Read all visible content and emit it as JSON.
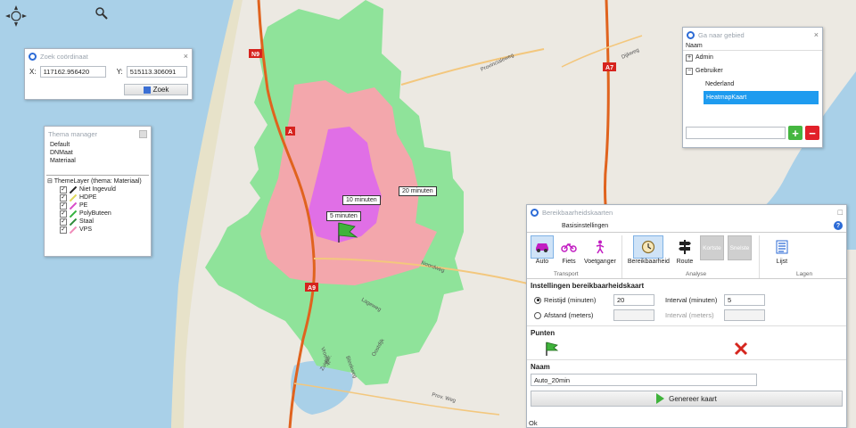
{
  "map": {
    "road_labels": {
      "a9_top": "N9",
      "a_left": "A",
      "a9_bottom": "A9",
      "a7": "A7",
      "provincialeweg": "Provincialeweg",
      "dijkweg": "Dijkweg",
      "lageweg": "Lageweg",
      "noordweg": "Noordweg",
      "zuidstraat": "Zuidstr.",
      "vroedijk": "Vroedijk",
      "bleekweg": "Bleekweg",
      "oostdijk": "Oostdijk",
      "prov_weg": "Prov. Weg"
    },
    "time_labels": {
      "m20": "20 minuten",
      "m10": "10 minuten",
      "m5": "5 minuten"
    },
    "colors": {
      "water": "#a9d0e8",
      "land": "#ece9e2",
      "zone20": "#8fe39a",
      "zone10": "#f3a7ac",
      "zone5": "#e06fe6",
      "highway": "#e0631e",
      "road": "#f3c77d"
    }
  },
  "nav_icons": {
    "pan": "compass-icon",
    "zoom": "magnifier-icon"
  },
  "coord_panel": {
    "title": "Zoek coördinaat",
    "x_label": "X:",
    "x_value": "117162.956420",
    "y_label": "Y:",
    "y_value": "515113.306091",
    "search_label": "Zoek"
  },
  "theme_manager": {
    "title": "Thema manager",
    "themes": [
      "Default",
      "DNMaat",
      "Materiaal"
    ],
    "layer_title": "ThemeLayer (thema: Materiaal)",
    "layers": [
      {
        "label": "Niet Ingevuld",
        "color": "#222222"
      },
      {
        "label": "HDPE",
        "color": "#e0d95a"
      },
      {
        "label": "PE",
        "color": "#d94bc8"
      },
      {
        "label": "PolyButeen",
        "color": "#33b23d"
      },
      {
        "label": "Staal",
        "color": "#2e8b3a"
      },
      {
        "label": "VPS",
        "color": "#f08ab8"
      }
    ]
  },
  "goto_panel": {
    "title": "Ga naar gebied",
    "header": "Naam",
    "items": [
      {
        "label": "Admin",
        "expander": "+"
      },
      {
        "label": "Gebruiker",
        "expander": "−"
      },
      {
        "label": "Nederland",
        "expander": ""
      },
      {
        "label": "HeatmapKaart",
        "expander": ""
      }
    ],
    "input_value": "",
    "add_symbol": "+",
    "remove_symbol": "−"
  },
  "reach_panel": {
    "title": "Bereikbaarheidskaarten",
    "tab": "Basisinstellingen",
    "help": "?",
    "groups": {
      "transport": "Transport",
      "analyse": "Analyse",
      "lagen": "Lagen"
    },
    "buttons": {
      "auto": "Auto",
      "fiets": "Fiets",
      "voetganger": "Voetganger",
      "bereikbaarheid": "Bereikbaarheid",
      "route": "Route",
      "kortste": "Kortste",
      "snelste": "Snelste",
      "lijst": "Lijst"
    },
    "settings_title": "Instellingen bereikbaarheidskaart",
    "travel_time_label": "Reistijd (minuten)",
    "travel_time_value": "20",
    "interval_min_label": "Interval (minuten)",
    "interval_min_value": "5",
    "distance_label": "Afstand (meters)",
    "distance_value": "",
    "interval_m_label": "Interval (meters)",
    "interval_m_value": "",
    "points_title": "Punten",
    "name_title": "Naam",
    "name_value": "Auto_20min",
    "generate_label": "Genereer kaart",
    "status": "Ok"
  }
}
